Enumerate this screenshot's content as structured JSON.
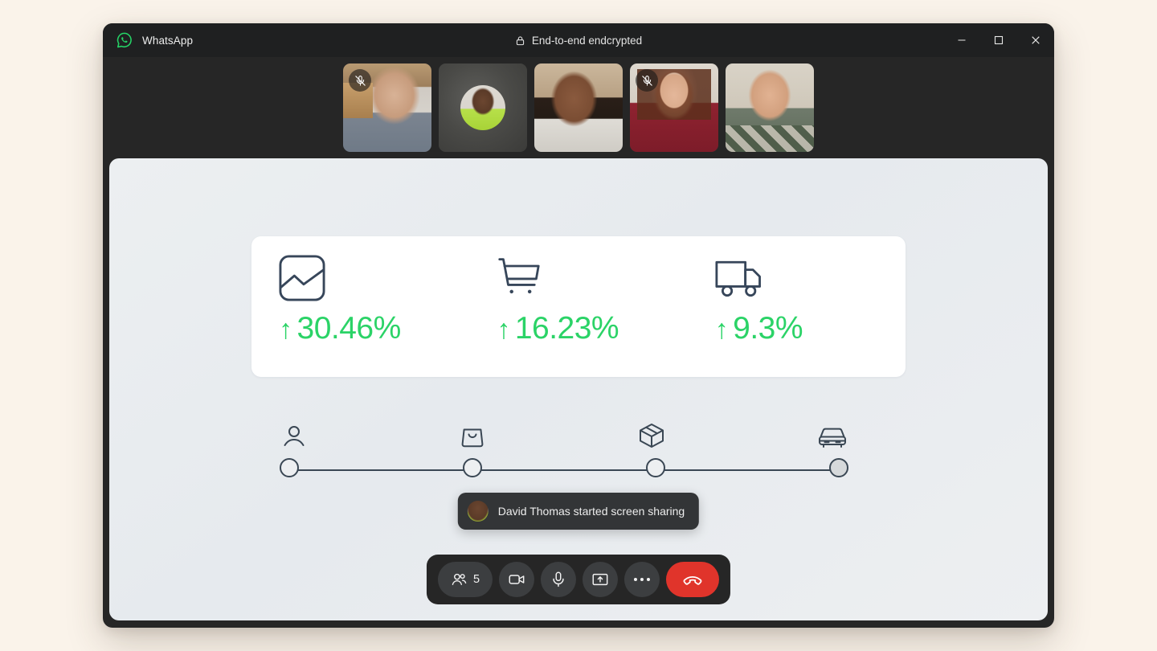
{
  "window": {
    "app_name": "WhatsApp",
    "logo_icon": "whatsapp-logo-icon",
    "encryption_label": "End-to-end endcrypted",
    "lock_icon": "lock-icon",
    "controls": {
      "minimize": "minimize-icon",
      "maximize": "maximize-icon",
      "close": "close-icon"
    },
    "accent_green": "#25D366",
    "titlebar_bg": "#1F2021",
    "body_bg": "#262626",
    "page_bg": "#FAF3EA"
  },
  "participants": [
    {
      "id": "p1",
      "video": true,
      "muted": true,
      "mic_icon": "mic-off-icon"
    },
    {
      "id": "p2",
      "video": false,
      "muted": false,
      "mic_icon": ""
    },
    {
      "id": "p3",
      "video": true,
      "muted": false,
      "mic_icon": ""
    },
    {
      "id": "p4",
      "video": true,
      "muted": true,
      "mic_icon": "mic-off-icon"
    },
    {
      "id": "p5",
      "video": true,
      "muted": false,
      "mic_icon": ""
    }
  ],
  "shared_screen": {
    "stats": [
      {
        "icon": "image-chart-icon",
        "arrow": "↑",
        "value": "30.46%"
      },
      {
        "icon": "shopping-cart-icon",
        "arrow": "↑",
        "value": "16.23%"
      },
      {
        "icon": "delivery-truck-icon",
        "arrow": "↑",
        "value": "9.3%"
      }
    ],
    "stat_value_color": "#2BD367",
    "stat_icon_color": "#37465A",
    "timeline": {
      "steps": [
        {
          "icon": "user-icon",
          "state": "empty"
        },
        {
          "icon": "shopping-bag-icon",
          "state": "empty"
        },
        {
          "icon": "package-box-icon",
          "state": "empty"
        },
        {
          "icon": "car-front-icon",
          "state": "filled"
        }
      ],
      "line_color": "#3A4754"
    }
  },
  "toast": {
    "avatar_icon": "participant-avatar",
    "message": "David Thomas started screen sharing"
  },
  "controlbar": {
    "participants": {
      "icon": "people-icon",
      "count": "5"
    },
    "camera": {
      "icon": "video-camera-icon"
    },
    "mic": {
      "icon": "microphone-icon"
    },
    "share": {
      "icon": "screen-share-icon"
    },
    "more": {
      "icon": "more-horizontal-icon"
    },
    "end": {
      "icon": "end-call-icon",
      "color": "#E0342B"
    }
  }
}
